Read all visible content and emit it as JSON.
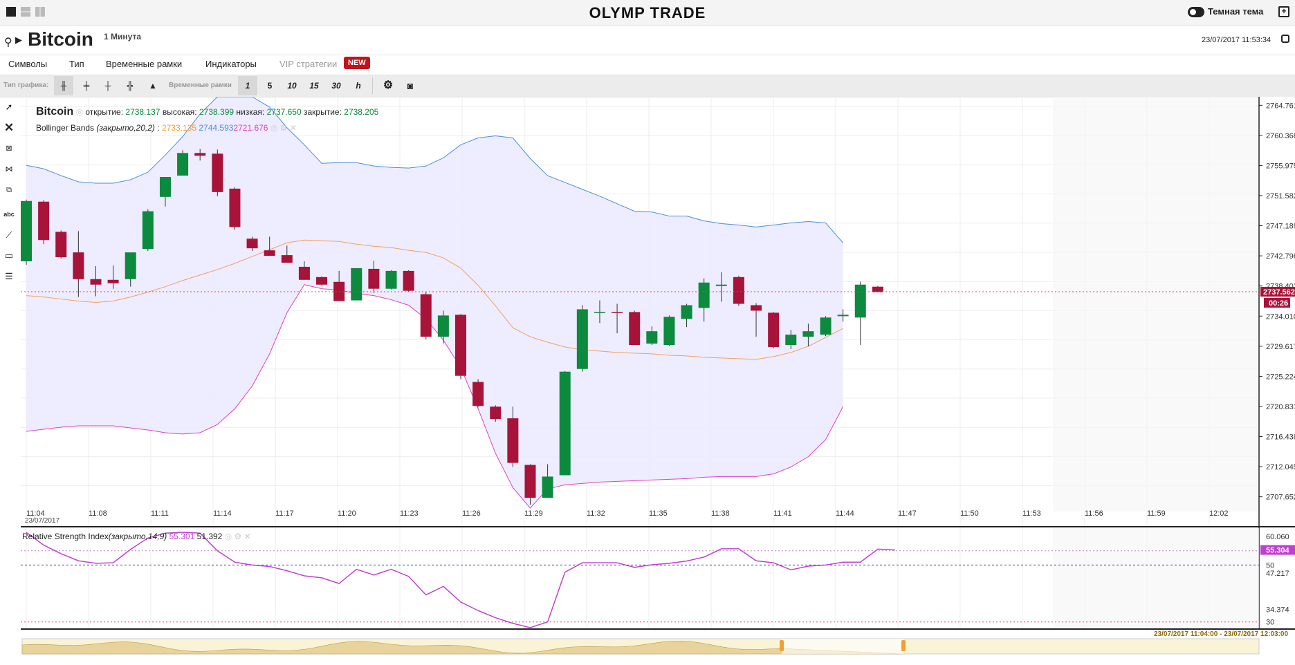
{
  "topbar": {
    "brand": "OLYMP TRADE",
    "theme_label": "Темная тема",
    "layout_icons": [
      "single-layout-icon",
      "split-horizontal-icon",
      "split-vertical-icon"
    ]
  },
  "header": {
    "asset": "Bitcoin",
    "timeframe": "1 Минута",
    "datetime": "23/07/2017 11:53:34"
  },
  "menu": {
    "items": [
      "Символы",
      "Тип",
      "Временные рамки",
      "Индикаторы"
    ],
    "vip": "VIP стратегии",
    "new_badge": "NEW"
  },
  "toolbar": {
    "chart_type_label": "Тип графика:",
    "timeframes_label": "Временные рамки",
    "timeframes": [
      "1",
      "5",
      "10",
      "15",
      "30",
      "h"
    ],
    "active_timeframe": "1"
  },
  "legend": {
    "asset": "Bitcoin",
    "open_label": "открытие:",
    "open": "2738.137",
    "high_label": "высокая:",
    "high": "2738.399",
    "low_label": "низкая:",
    "low": "2737.650",
    "close_label": "закрытие:",
    "close": "2738.205",
    "bb_label": "Bollinger Bands",
    "bb_params": "(закрыто,20,2)",
    "bb_sep": ":",
    "bb_mid": "2733.135",
    "bb_upper": "2744.593",
    "bb_lower": "2721.676",
    "rsi_label": "Relative Strength Index",
    "rsi_params": "(закрыто,14,9)",
    "rsi_value": "55.301",
    "rsi_signal": "51.392"
  },
  "price_axis": {
    "ticks": [
      "2764.761",
      "2760.368",
      "2755.975",
      "2751.582",
      "2747.189",
      "2742.796",
      "2738.403",
      "2734.010",
      "2729.617",
      "2725.224",
      "2720.831",
      "2716.438",
      "2712.045",
      "2707.652"
    ],
    "current_price": "2737.562",
    "countdown": "00:26"
  },
  "rsi_axis": {
    "ticks": [
      "60.060",
      "50",
      "47.217",
      "34.374",
      "30"
    ],
    "current": "55.304"
  },
  "time_axis": {
    "ticks": [
      "11:04",
      "11:08",
      "11:11",
      "11:14",
      "11:17",
      "11:20",
      "11:23",
      "11:26",
      "11:29",
      "11:32",
      "11:35",
      "11:38",
      "11:41",
      "11:44",
      "11:47",
      "11:50",
      "11:53",
      "11:56",
      "11:59",
      "12:02"
    ],
    "date": "23/07/2017"
  },
  "navigator": {
    "range": "23/07/2017 11:04:00 - 23/07/2017 12:03:00"
  },
  "colors": {
    "up": "#0c8a3e",
    "down": "#a8133a",
    "bb_upper": "#4a90d9",
    "bb_mid": "#f0a060",
    "bb_lower": "#e040c0",
    "bb_fill": "#ebe9ff",
    "rsi": "#c040d0",
    "price_marker": "#a8133a"
  },
  "chart_data": {
    "type": "candlestick",
    "title": "Bitcoin",
    "ylim": [
      2705.5,
      2766.0
    ],
    "candles": [
      {
        "t": "11:03",
        "o": 2742.0,
        "h": 2751.0,
        "l": 2741.5,
        "c": 2750.8
      },
      {
        "t": "11:04",
        "o": 2750.7,
        "h": 2750.9,
        "l": 2744.5,
        "c": 2745.1
      },
      {
        "t": "11:05",
        "o": 2746.3,
        "h": 2746.5,
        "l": 2742.4,
        "c": 2742.6
      },
      {
        "t": "11:06",
        "o": 2743.3,
        "h": 2746.4,
        "l": 2736.8,
        "c": 2739.4
      },
      {
        "t": "11:07",
        "o": 2739.4,
        "h": 2741.3,
        "l": 2736.9,
        "c": 2738.6
      },
      {
        "t": "11:08",
        "o": 2739.3,
        "h": 2741.4,
        "l": 2738.0,
        "c": 2738.8
      },
      {
        "t": "11:09",
        "o": 2739.4,
        "h": 2742.8,
        "l": 2738.3,
        "c": 2743.3
      },
      {
        "t": "11:10",
        "o": 2743.8,
        "h": 2749.6,
        "l": 2743.5,
        "c": 2749.3
      },
      {
        "t": "11:11",
        "o": 2751.4,
        "h": 2753.4,
        "l": 2750.0,
        "c": 2754.3
      },
      {
        "t": "11:12",
        "o": 2754.5,
        "h": 2758.2,
        "l": 2754.5,
        "c": 2757.8
      },
      {
        "t": "11:13",
        "o": 2757.8,
        "h": 2758.4,
        "l": 2756.7,
        "c": 2757.4
      },
      {
        "t": "11:14",
        "o": 2757.7,
        "h": 2758.3,
        "l": 2751.5,
        "c": 2752.1
      },
      {
        "t": "11:15",
        "o": 2752.6,
        "h": 2752.8,
        "l": 2746.6,
        "c": 2747.0
      },
      {
        "t": "11:16",
        "o": 2745.3,
        "h": 2745.6,
        "l": 2743.5,
        "c": 2743.9
      },
      {
        "t": "11:17",
        "o": 2743.6,
        "h": 2745.6,
        "l": 2743.1,
        "c": 2742.8
      },
      {
        "t": "11:18",
        "o": 2742.9,
        "h": 2744.3,
        "l": 2741.8,
        "c": 2741.8
      },
      {
        "t": "11:19",
        "o": 2741.2,
        "h": 2742.0,
        "l": 2740.2,
        "c": 2739.3
      },
      {
        "t": "11:20",
        "o": 2739.7,
        "h": 2739.8,
        "l": 2738.5,
        "c": 2738.6
      },
      {
        "t": "11:21",
        "o": 2739.0,
        "h": 2740.6,
        "l": 2736.5,
        "c": 2736.2
      },
      {
        "t": "11:22",
        "o": 2736.3,
        "h": 2741.0,
        "l": 2736.8,
        "c": 2741.0
      },
      {
        "t": "11:23",
        "o": 2740.9,
        "h": 2742.1,
        "l": 2737.4,
        "c": 2738.0
      },
      {
        "t": "11:24",
        "o": 2738.0,
        "h": 2740.7,
        "l": 2737.9,
        "c": 2740.6
      },
      {
        "t": "11:25",
        "o": 2740.6,
        "h": 2740.7,
        "l": 2737.6,
        "c": 2737.7
      },
      {
        "t": "11:26",
        "o": 2737.2,
        "h": 2737.5,
        "l": 2730.6,
        "c": 2731.0
      },
      {
        "t": "11:27",
        "o": 2731.0,
        "h": 2734.8,
        "l": 2730.0,
        "c": 2734.1
      },
      {
        "t": "11:28",
        "o": 2734.2,
        "h": 2734.3,
        "l": 2724.8,
        "c": 2725.3
      },
      {
        "t": "11:29",
        "o": 2724.4,
        "h": 2724.8,
        "l": 2720.7,
        "c": 2720.9
      },
      {
        "t": "11:30",
        "o": 2720.8,
        "h": 2721.0,
        "l": 2718.6,
        "c": 2719.0
      },
      {
        "t": "11:31",
        "o": 2719.1,
        "h": 2720.8,
        "l": 2712.0,
        "c": 2712.6
      },
      {
        "t": "11:32",
        "o": 2712.3,
        "h": 2712.4,
        "l": 2706.5,
        "c": 2707.5
      },
      {
        "t": "11:33",
        "o": 2707.5,
        "h": 2712.4,
        "l": 2707.5,
        "c": 2710.6
      },
      {
        "t": "11:34",
        "o": 2710.8,
        "h": 2726.0,
        "l": 2710.8,
        "c": 2725.9
      },
      {
        "t": "11:35",
        "o": 2726.3,
        "h": 2735.6,
        "l": 2725.9,
        "c": 2735.0
      },
      {
        "t": "11:36",
        "o": 2734.6,
        "h": 2736.3,
        "l": 2733.0,
        "c": 2734.6
      },
      {
        "t": "11:37",
        "o": 2734.6,
        "h": 2735.8,
        "l": 2731.5,
        "c": 2734.5
      },
      {
        "t": "11:38",
        "o": 2734.6,
        "h": 2734.8,
        "l": 2729.8,
        "c": 2729.8
      },
      {
        "t": "11:39",
        "o": 2730.0,
        "h": 2732.5,
        "l": 2729.8,
        "c": 2731.8
      },
      {
        "t": "11:40",
        "o": 2729.8,
        "h": 2734.1,
        "l": 2729.7,
        "c": 2733.9
      },
      {
        "t": "11:41",
        "o": 2733.6,
        "h": 2735.8,
        "l": 2732.4,
        "c": 2735.6
      },
      {
        "t": "11:42",
        "o": 2735.2,
        "h": 2739.5,
        "l": 2733.2,
        "c": 2738.9
      },
      {
        "t": "11:43",
        "o": 2738.4,
        "h": 2740.4,
        "l": 2736.1,
        "c": 2738.6
      },
      {
        "t": "11:44",
        "o": 2739.7,
        "h": 2739.9,
        "l": 2735.5,
        "c": 2735.8
      },
      {
        "t": "11:45",
        "o": 2735.6,
        "h": 2735.9,
        "l": 2731.0,
        "c": 2734.8
      },
      {
        "t": "11:46",
        "o": 2734.5,
        "h": 2734.6,
        "l": 2729.3,
        "c": 2729.5
      },
      {
        "t": "11:47",
        "o": 2729.8,
        "h": 2732.0,
        "l": 2729.2,
        "c": 2731.3
      },
      {
        "t": "11:48",
        "o": 2731.0,
        "h": 2732.9,
        "l": 2729.6,
        "c": 2731.8
      },
      {
        "t": "11:49",
        "o": 2731.3,
        "h": 2734.0,
        "l": 2731.1,
        "c": 2733.8
      },
      {
        "t": "11:50",
        "o": 2734.0,
        "h": 2735.0,
        "l": 2733.2,
        "c": 2734.2
      },
      {
        "t": "11:51",
        "o": 2733.8,
        "h": 2739.0,
        "l": 2729.8,
        "c": 2738.6
      },
      {
        "t": "11:52",
        "o": 2738.3,
        "h": 2738.4,
        "l": 2737.6,
        "c": 2737.5
      }
    ],
    "bb_upper": [
      2756.0,
      2755.5,
      2754.5,
      2753.6,
      2753.4,
      2753.4,
      2753.9,
      2755.0,
      2757.5,
      2760.2,
      2763.5,
      2766.0,
      2766.0,
      2766.0,
      2764.5,
      2761.5,
      2759.0,
      2756.3,
      2756.4,
      2756.4,
      2755.9,
      2755.7,
      2755.6,
      2755.9,
      2757.1,
      2759.0,
      2760.0,
      2760.3,
      2760.0,
      2757.0,
      2754.5,
      2753.5,
      2752.5,
      2751.5,
      2750.4,
      2749.3,
      2749.2,
      2748.6,
      2748.6,
      2747.9,
      2747.5,
      2747.3,
      2747.0,
      2747.3,
      2747.6,
      2747.8,
      2747.6,
      2744.7
    ],
    "bb_mid": [
      2737.0,
      2736.8,
      2736.5,
      2736.2,
      2736.0,
      2736.2,
      2736.8,
      2737.5,
      2738.3,
      2739.2,
      2740.0,
      2740.8,
      2741.7,
      2742.7,
      2743.7,
      2744.7,
      2745.1,
      2745.0,
      2744.9,
      2744.5,
      2744.2,
      2744.0,
      2743.6,
      2743.3,
      2742.5,
      2741.0,
      2738.5,
      2735.5,
      2732.3,
      2731.0,
      2730.2,
      2729.5,
      2729.1,
      2728.9,
      2728.7,
      2728.6,
      2728.5,
      2728.3,
      2728.2,
      2728.0,
      2727.9,
      2727.8,
      2727.7,
      2728.1,
      2728.7,
      2729.6,
      2730.9,
      2732.2
    ],
    "bb_lower": [
      2717.2,
      2717.5,
      2717.8,
      2718.0,
      2718.0,
      2718.0,
      2717.7,
      2717.4,
      2717.0,
      2716.8,
      2717.0,
      2718.2,
      2720.5,
      2723.8,
      2728.5,
      2734.5,
      2738.6,
      2738.0,
      2737.8,
      2737.3,
      2737.0,
      2736.4,
      2735.6,
      2733.6,
      2730.5,
      2726.5,
      2720.5,
      2714.0,
      2709.0,
      2706.0,
      2708.8,
      2709.4,
      2709.6,
      2709.8,
      2709.9,
      2710.0,
      2710.1,
      2710.2,
      2710.3,
      2710.5,
      2710.6,
      2710.6,
      2710.6,
      2711.0,
      2712.0,
      2713.5,
      2716.0,
      2720.8
    ],
    "rsi": [
      61.5,
      57.0,
      54.0,
      51.5,
      50.6,
      50.8,
      55.5,
      59.5,
      61.2,
      61.5,
      61.2,
      55.0,
      51.0,
      50.0,
      49.5,
      48.0,
      46.2,
      45.5,
      43.5,
      48.5,
      46.5,
      48.5,
      46.0,
      39.5,
      42.5,
      37.0,
      34.0,
      31.5,
      29.5,
      28.0,
      30.0,
      47.5,
      50.8,
      50.8,
      50.8,
      49.2,
      50.1,
      50.6,
      51.4,
      52.8,
      55.7,
      55.7,
      51.5,
      50.8,
      48.3,
      49.6,
      50.0,
      51.0,
      51.0,
      55.6,
      55.3
    ],
    "rsi_ylim": [
      27.5,
      62.0
    ],
    "rsi_levels": [
      30,
      50
    ]
  }
}
